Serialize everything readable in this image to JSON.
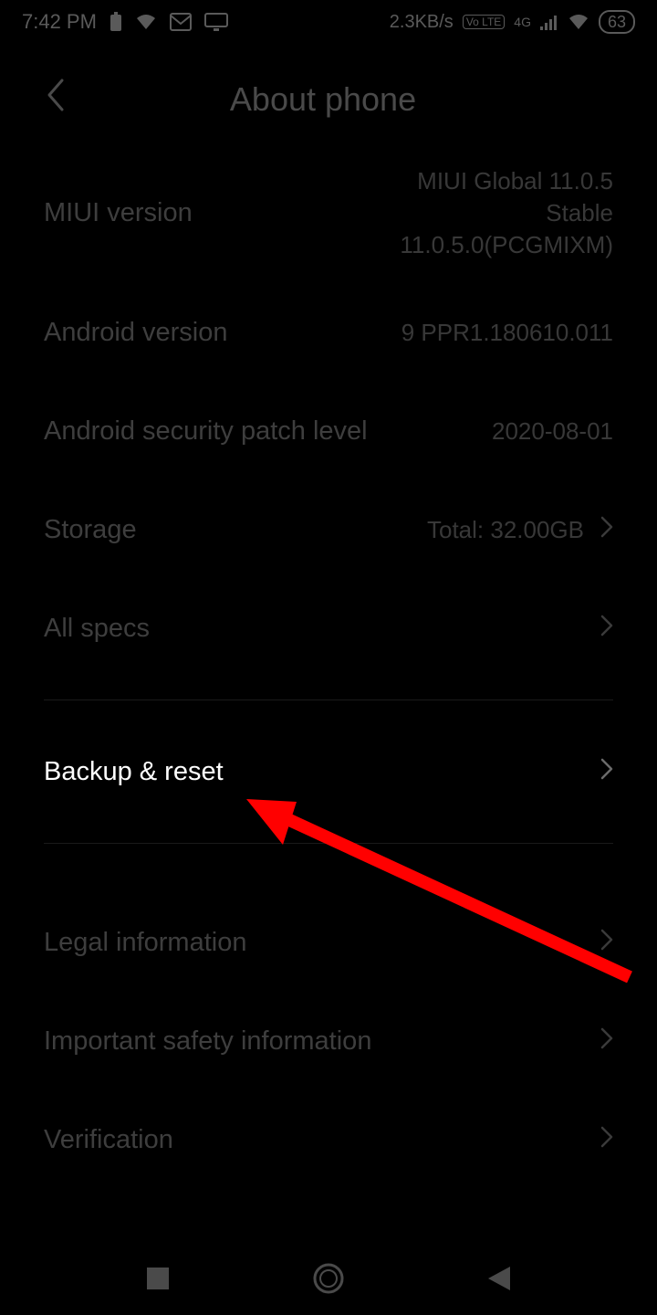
{
  "status": {
    "time": "7:42 PM",
    "net_speed": "2.3KB/s",
    "volte": "Vo LTE",
    "signal": "4G",
    "battery_pct": "63"
  },
  "header": {
    "title": "About phone"
  },
  "rows": {
    "miui": {
      "label": "MIUI version",
      "value": "MIUI Global 11.0.5\nStable\n11.0.5.0(PCGMIXM)"
    },
    "android": {
      "label": "Android version",
      "value": "9 PPR1.180610.011"
    },
    "security": {
      "label": "Android security patch level",
      "value": "2020-08-01"
    },
    "storage": {
      "label": "Storage",
      "value": "Total: 32.00GB"
    },
    "allspecs": {
      "label": "All specs"
    },
    "backup": {
      "label": "Backup & reset"
    },
    "legal": {
      "label": "Legal information"
    },
    "safety": {
      "label": "Important safety information"
    },
    "verification": {
      "label": "Verification"
    }
  },
  "annotation": {
    "color": "#ff0000"
  }
}
